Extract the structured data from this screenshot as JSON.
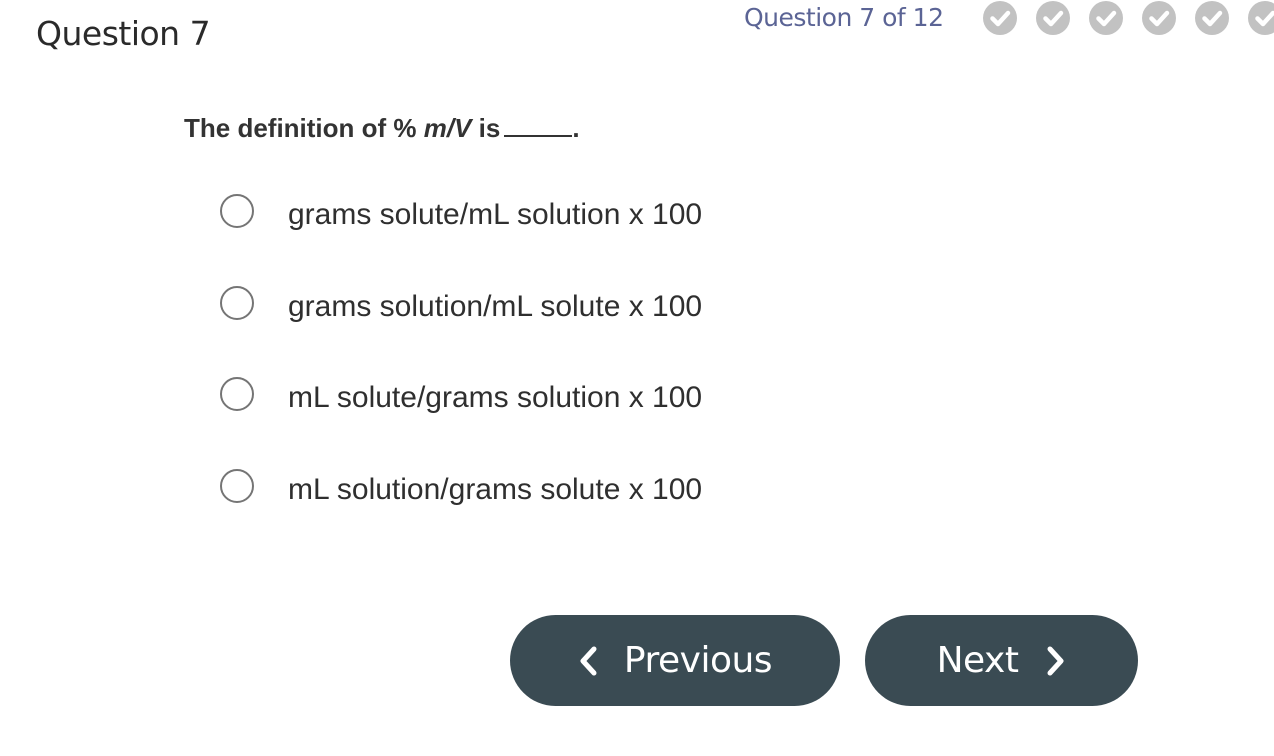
{
  "header": {
    "title": "Question 7",
    "progress_text": "Question 7 of 12",
    "progress_icons": [
      "check-circle-icon",
      "check-circle-icon",
      "check-circle-icon",
      "check-circle-icon",
      "check-circle-icon",
      "check-circle-icon"
    ]
  },
  "question": {
    "prompt_prefix": "The definition of % ",
    "prompt_italic": "m/V",
    "prompt_suffix": " is",
    "prompt_end": ".",
    "options": [
      {
        "label": "grams solute/mL solution x 100",
        "selected": false
      },
      {
        "label": "grams solution/mL solute x 100",
        "selected": false
      },
      {
        "label": "mL solute/grams solution x 100",
        "selected": false
      },
      {
        "label": "mL solution/grams solute x 100",
        "selected": false
      }
    ]
  },
  "navigation": {
    "previous_label": "Previous",
    "next_label": "Next"
  },
  "colors": {
    "progress_text": "#5b6495",
    "check_circle": "#c2c2c2",
    "button_bg": "#3a4b53",
    "button_text": "#ffffff"
  }
}
